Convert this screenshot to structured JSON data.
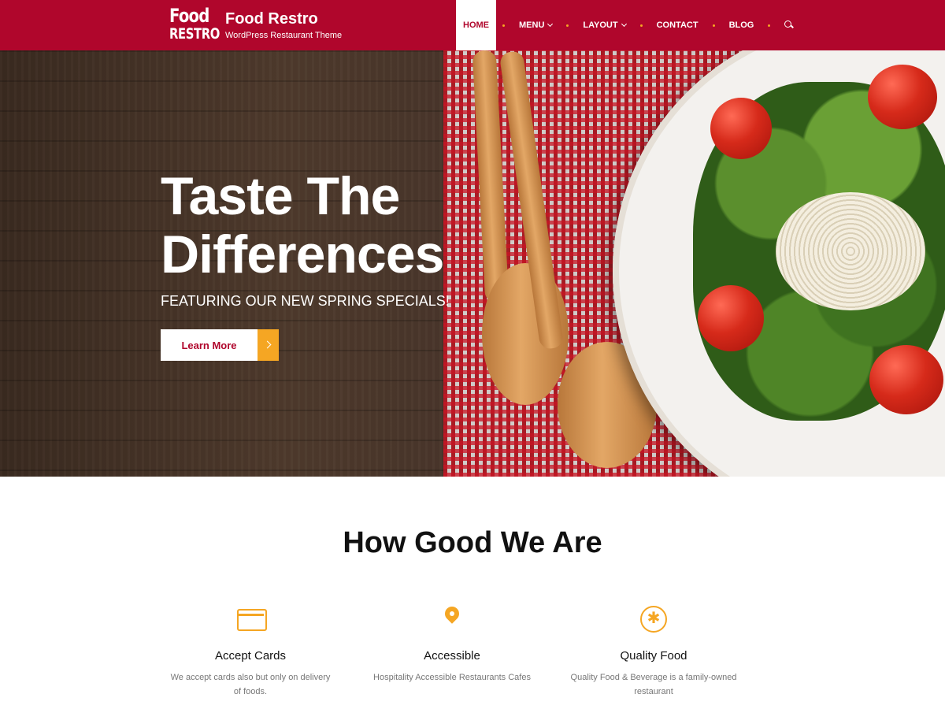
{
  "brand": {
    "logo_line1": "Food",
    "logo_line2": "RESTRO",
    "title": "Food Restro",
    "tagline": "WordPress Restaurant Theme"
  },
  "nav": {
    "items": [
      {
        "label": "HOME",
        "active": true
      },
      {
        "label": "MENU",
        "dropdown": true
      },
      {
        "label": "LAYOUT",
        "dropdown": true
      },
      {
        "label": "CONTACT"
      },
      {
        "label": "BLOG"
      }
    ],
    "search_icon": "search-icon"
  },
  "hero": {
    "title_line1": "Taste The",
    "title_line2": "Differences",
    "subtitle": "FEATURING OUR NEW SPRING SPECIALS!",
    "button_label": "Learn More"
  },
  "features": {
    "title": "How Good We Are",
    "items": [
      {
        "icon": "credit-card-icon",
        "title": "Accept Cards",
        "desc_line1": "We accept cards also but only on delivery",
        "desc_line2": "of foods."
      },
      {
        "icon": "map-pin-icon",
        "title": "Accessible",
        "desc_line1": "Hospitality Accessible Restaurants Cafes",
        "desc_line2": ""
      },
      {
        "icon": "star-badge-icon",
        "title": "Quality Food",
        "desc_line1": "Quality Food & Beverage is a family-owned",
        "desc_line2": "restaurant"
      }
    ]
  },
  "colors": {
    "brand_red": "#b0062c",
    "accent_orange": "#f5a623"
  }
}
